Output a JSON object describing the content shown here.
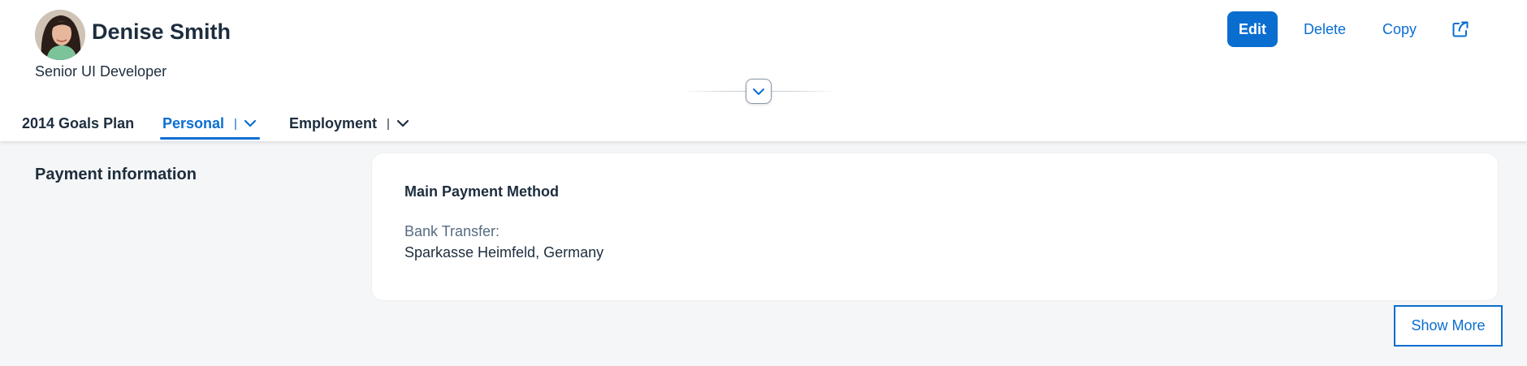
{
  "header": {
    "title": "Denise Smith",
    "subtitle": "Senior UI Developer",
    "actions": {
      "edit": "Edit",
      "delete": "Delete",
      "copy": "Copy",
      "share_icon": "share-icon"
    },
    "collapse_icon": "chevron-down-icon"
  },
  "tabs": [
    {
      "label": "2014 Goals Plan",
      "active": false,
      "has_menu": false
    },
    {
      "label": "Personal",
      "separator": "|",
      "active": true,
      "has_menu": true
    },
    {
      "label": "Employment",
      "separator": "|",
      "active": false,
      "has_menu": true
    }
  ],
  "section": {
    "title": "Payment information",
    "card": {
      "title": "Main Payment Method",
      "label": "Bank Transfer:",
      "value": "Sparkasse Heimfeld, Germany"
    },
    "show_more": "Show More"
  },
  "colors": {
    "accent": "#0a6ed1",
    "text": "#1d2d3e",
    "muted_text": "#556b82",
    "background": "#f5f6f7",
    "surface": "#ffffff"
  }
}
